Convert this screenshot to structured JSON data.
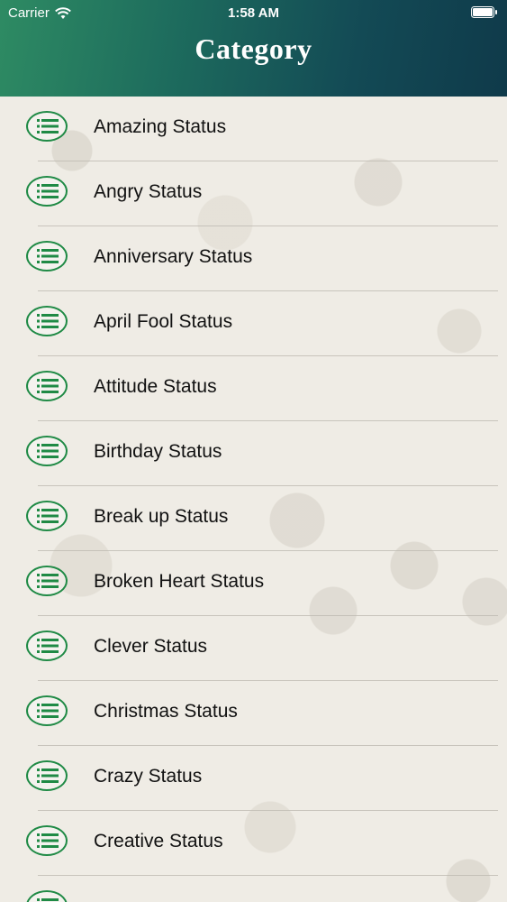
{
  "status_bar": {
    "carrier": "Carrier",
    "time": "1:58 AM"
  },
  "header": {
    "title": "Category"
  },
  "colors": {
    "accent": "#1f8a45",
    "header_start": "#2e8b63",
    "header_end": "#0f3a4a"
  },
  "categories": [
    {
      "label": "Amazing Status"
    },
    {
      "label": "Angry Status"
    },
    {
      "label": "Anniversary Status"
    },
    {
      "label": "April Fool Status"
    },
    {
      "label": "Attitude Status"
    },
    {
      "label": "Birthday Status"
    },
    {
      "label": "Break up Status"
    },
    {
      "label": "Broken Heart Status"
    },
    {
      "label": "Clever Status"
    },
    {
      "label": "Christmas Status"
    },
    {
      "label": "Crazy Status"
    },
    {
      "label": "Creative Status"
    }
  ]
}
